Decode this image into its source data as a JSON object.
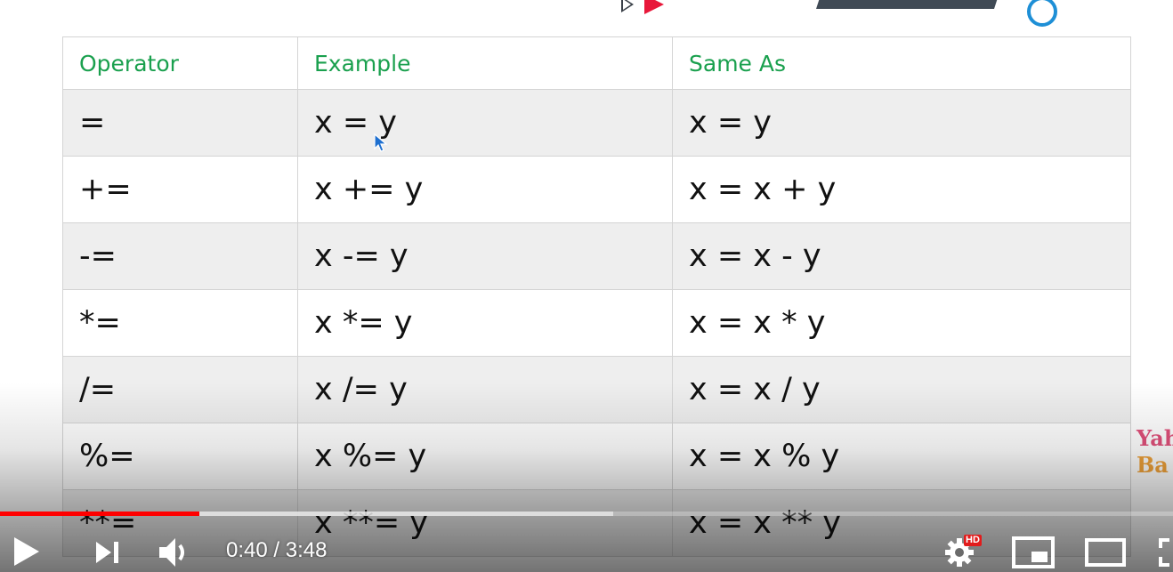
{
  "slide": {
    "columns": [
      "Operator",
      "Example",
      "Same As"
    ],
    "rows": [
      [
        "=",
        "x = y",
        "x = y"
      ],
      [
        "+=",
        "x += y",
        "x = x + y"
      ],
      [
        "-=",
        "x -= y",
        "x = x - y"
      ],
      [
        "*=",
        "x *= y",
        "x = x * y"
      ],
      [
        "/=",
        "x /= y",
        "x = x / y"
      ],
      [
        "%=",
        "x %= y",
        "x = x % y"
      ],
      [
        "**=",
        "x **= y",
        "x = x ** y"
      ]
    ],
    "watermark": {
      "line1": "Yah",
      "line2": "Ba"
    },
    "colors": {
      "header_text": "#1aa04e",
      "row_stripe": "#eeeeee",
      "border": "#d4d4d4"
    }
  },
  "player": {
    "time_current": "0:40",
    "time_separator": " / ",
    "time_total": "3:48",
    "played_fraction": 0.17,
    "buffered_fraction": 0.523,
    "hd_badge": "HD",
    "icons": {
      "play": "play-icon",
      "next": "next-icon",
      "volume": "volume-icon",
      "settings": "gear-icon",
      "miniplayer": "miniplayer-icon",
      "theater": "theater-mode-icon",
      "fullscreen": "fullscreen-icon"
    },
    "colors": {
      "played": "#ff0000",
      "hd": "#e21b1b"
    }
  }
}
